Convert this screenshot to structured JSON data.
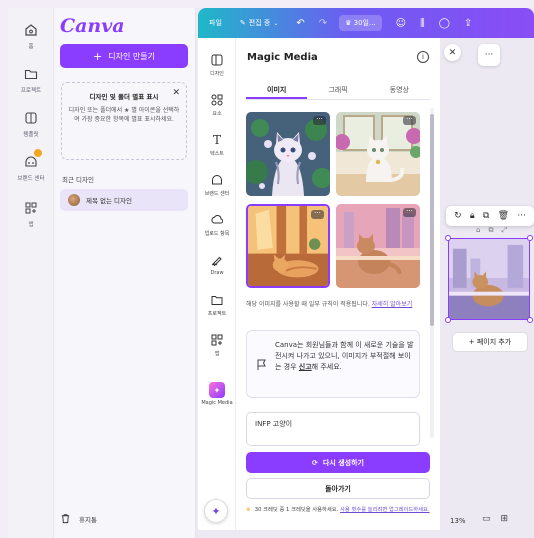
{
  "rail": {
    "items": [
      {
        "icon": "home-icon",
        "label": "홈"
      },
      {
        "icon": "folder-icon",
        "label": "프로젝트"
      },
      {
        "icon": "template-icon",
        "label": "템플릿"
      },
      {
        "icon": "brand-icon",
        "label": "브랜드 센터"
      },
      {
        "icon": "apps-icon",
        "label": "앱"
      }
    ]
  },
  "home": {
    "logo": "Canva",
    "create_label": "디자인 만들기",
    "tip_title": "디자인 및 폴더 별표 표시",
    "tip_body": "디자인 또는 폴더에서 ★ 별 아이콘을 선택하여 가장 중요한 항목에 별표 표시하세요.",
    "recent_label": "최근 디자인",
    "recent_item": "제목 없는 디자인",
    "trash_label": "휴지통"
  },
  "topbar": {
    "file_label": "파일",
    "edit_label": "편집 중",
    "credits_label": "30일...",
    "accent_start": "#1fb8c8",
    "accent_end": "#8a4df6"
  },
  "tools": [
    {
      "icon": "design-icon",
      "label": "디자인"
    },
    {
      "icon": "elements-icon",
      "label": "요소"
    },
    {
      "icon": "text-icon",
      "label": "텍스트"
    },
    {
      "icon": "brand-icon",
      "label": "브랜드 센터"
    },
    {
      "icon": "upload-icon",
      "label": "업로드 항목"
    },
    {
      "icon": "draw-icon",
      "label": "Draw"
    },
    {
      "icon": "projects-icon",
      "label": "프로젝트"
    },
    {
      "icon": "apps-icon",
      "label": "앱"
    },
    {
      "icon": "magic-media-icon",
      "label": "Magic Media"
    }
  ],
  "magic": {
    "title": "Magic Media",
    "tabs": [
      "이미지",
      "그래픽",
      "동영상"
    ],
    "active_tab": "이미지",
    "note_text": "해당 이미지를 사용할 때 일부 규칙이 적용됩니다.",
    "note_link": "자세히 알아보기",
    "notice_pre": "Canva는 회원님들과 함께 이 새로운 기술을 발전시켜 나가고 있으니, 이미지가 부적절해 보이는 경우 ",
    "notice_link": "신고",
    "notice_post": "해 주세요.",
    "prompt_value": "INFP 고양이",
    "regen_label": "다시 생성하기",
    "back_label": "돌아가기",
    "credit_text": "30 크레딧 중 1 크레딧을 사용하세요.",
    "credit_link": "사용 횟수를 늘리려면 업그레이드하세요."
  },
  "canvas": {
    "add_page_label": "+ 페이지 추가",
    "zoom_label": "13%"
  },
  "colors": {
    "brand": "#8b3dff"
  }
}
